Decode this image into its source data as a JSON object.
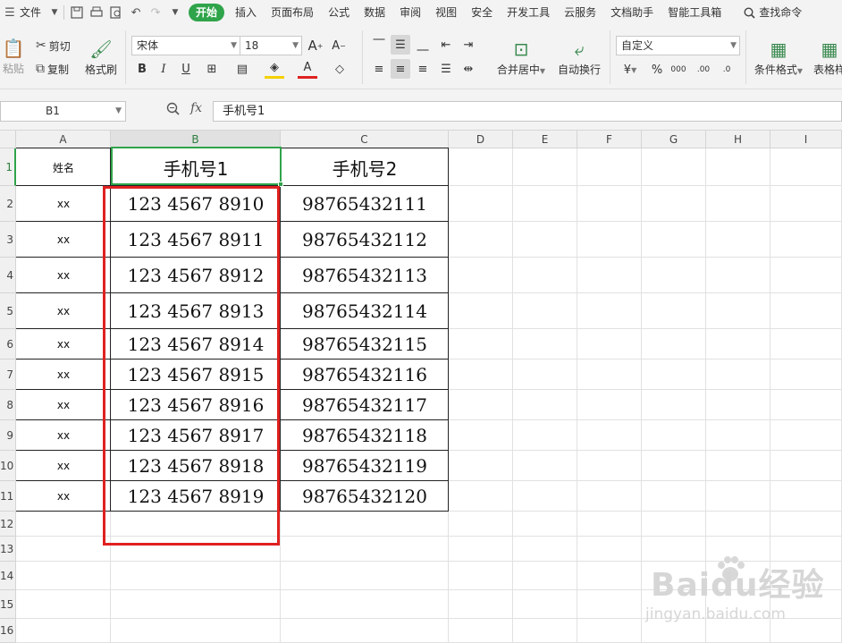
{
  "menubar": {
    "file": "文件",
    "tabs": [
      "开始",
      "插入",
      "页面布局",
      "公式",
      "数据",
      "审阅",
      "视图",
      "安全",
      "开发工具",
      "云服务",
      "文档助手",
      "智能工具箱"
    ],
    "active_tab": "开始",
    "search": "查找命令"
  },
  "ribbon": {
    "paste": "粘贴",
    "cut": "剪切",
    "copy": "复制",
    "format_painter": "格式刷",
    "font_name": "宋体",
    "font_size": "18",
    "merge_center": "合并居中",
    "wrap_text": "自动换行",
    "number_format": "自定义",
    "percent": "%",
    "thousands": "000",
    "inc_decimal": ".00",
    "dec_decimal": ".0",
    "conditional_format": "条件格式",
    "table_style": "表格样"
  },
  "formula_bar": {
    "name_box": "B1",
    "fx": "fx",
    "formula": "手机号1"
  },
  "sheet": {
    "columns": [
      "A",
      "B",
      "C",
      "D",
      "E",
      "F",
      "G",
      "H",
      "I"
    ],
    "rows": [
      "1",
      "2",
      "3",
      "4",
      "5",
      "6",
      "7",
      "8",
      "9",
      "10",
      "11",
      "12",
      "13",
      "14",
      "15",
      "16"
    ],
    "header": [
      "姓名",
      "手机号1",
      "手机号2"
    ],
    "data": [
      [
        "xx",
        "123 4567 8910",
        "98765432111"
      ],
      [
        "xx",
        "123 4567 8911",
        "98765432112"
      ],
      [
        "xx",
        "123 4567 8912",
        "98765432113"
      ],
      [
        "xx",
        "123 4567 8913",
        "98765432114"
      ],
      [
        "xx",
        "123 4567 8914",
        "98765432115"
      ],
      [
        "xx",
        "123 4567 8915",
        "98765432116"
      ],
      [
        "xx",
        "123 4567 8916",
        "98765432117"
      ],
      [
        "xx",
        "123 4567 8917",
        "98765432118"
      ],
      [
        "xx",
        "123 4567 8918",
        "98765432119"
      ],
      [
        "xx",
        "123 4567 8919",
        "98765432120"
      ]
    ],
    "selected_cell": "B1"
  },
  "watermark": {
    "logo": "Baidu经验",
    "url": "jingyan.baidu.com"
  },
  "colors": {
    "accent": "#2fa44a",
    "highlight_box": "#e02020"
  }
}
